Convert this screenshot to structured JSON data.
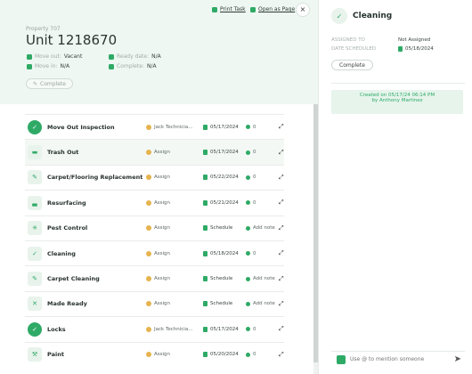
{
  "header": {
    "print_task": "Print Task",
    "open_as_page": "Open as Page",
    "close": "×",
    "property": "Property 707",
    "unit": "Unit 1218670",
    "move_out_label": "Move out:",
    "move_out_value": "Vacant",
    "move_in_label": "Move in:",
    "move_in_value": "N/A",
    "ready_date_label": "Ready date:",
    "ready_date_value": "N/A",
    "complete_label": "Complete:",
    "complete_value": "N/A",
    "complete_button": "Complete"
  },
  "tasks": [
    {
      "name": "Move Out Inspection",
      "status": "done",
      "icon": "check",
      "assignee": "Jack Technicia...",
      "type": "date",
      "date": "05/17/2024",
      "note": "0"
    },
    {
      "name": "Trash Out",
      "status": "todo",
      "icon": "trash",
      "assignee": "Assign",
      "type": "date",
      "date": "05/17/2024",
      "note": "0"
    },
    {
      "name": "Carpet/Flooring Replacement",
      "status": "todo",
      "icon": "brush",
      "assignee": "Assign",
      "type": "date",
      "date": "05/22/2024",
      "note": "0"
    },
    {
      "name": "Resurfacing",
      "status": "todo",
      "icon": "tub",
      "assignee": "Assign",
      "type": "date",
      "date": "05/21/2024",
      "note": "0"
    },
    {
      "name": "Pest Control",
      "status": "todo",
      "icon": "bug",
      "assignee": "Assign",
      "type": "schedule",
      "date": "Schedule",
      "note": "Add note"
    },
    {
      "name": "Cleaning",
      "status": "todo",
      "icon": "check",
      "assignee": "Assign",
      "type": "date",
      "date": "05/18/2024",
      "note": "0"
    },
    {
      "name": "Carpet Cleaning",
      "status": "todo",
      "icon": "brush",
      "assignee": "Assign",
      "type": "schedule",
      "date": "Schedule",
      "note": "Add note"
    },
    {
      "name": "Made Ready",
      "status": "todo",
      "icon": "tools",
      "assignee": "Assign",
      "type": "schedule",
      "date": "Schedule",
      "note": "Add note"
    },
    {
      "name": "Locks",
      "status": "done",
      "icon": "check",
      "assignee": "Jack Technicia...",
      "type": "date",
      "date": "05/17/2024",
      "note": "0"
    },
    {
      "name": "Paint",
      "status": "todo",
      "icon": "roller",
      "assignee": "Assign",
      "type": "date",
      "date": "05/20/2024",
      "note": "0"
    }
  ],
  "detail": {
    "title": "Cleaning",
    "assigned_to_label": "ASSIGNED TO",
    "assigned_to_value": "Not Assigned",
    "date_scheduled_label": "DATE SCHEDULED",
    "date_scheduled_value": "05/18/2024",
    "complete_button": "Complete",
    "created_on": "Created on  05/17/24 06:14 PM",
    "created_by": "by Anthony Martinez",
    "comment_placeholder": "Use @ to mention someone"
  },
  "colors": {
    "accent": "#2eaa66",
    "header_bg": "#eef7f2",
    "activity_bg": "#e6f4ec"
  }
}
